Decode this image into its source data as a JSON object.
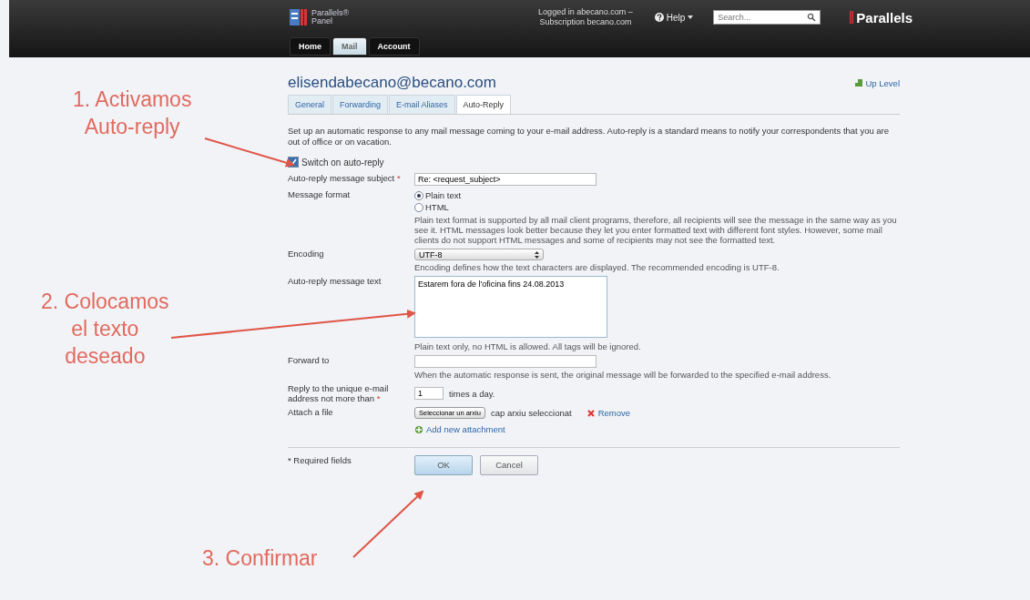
{
  "header": {
    "logo_text": "Parallels®\nPanel",
    "login_info": "Logged in abecano.com –\nSubscription becano.com",
    "help": "Help",
    "search": {
      "placeholder": "Search..."
    },
    "brand": "Parallels"
  },
  "nav_tabs": [
    {
      "label": "Home",
      "selected": false
    },
    {
      "label": "Mail",
      "selected": true
    },
    {
      "label": "Account",
      "selected": false
    }
  ],
  "title": "elisendabecano@becano.com",
  "up_level": "Up Level",
  "sub_tabs": [
    {
      "label": "General",
      "selected": false
    },
    {
      "label": "Forwarding",
      "selected": false
    },
    {
      "label": "E-mail Aliases",
      "selected": false
    },
    {
      "label": "Auto-Reply",
      "selected": true
    }
  ],
  "intro": "Set up an automatic response to any mail message coming to your e-mail address. Auto-reply is a standard means to notify your correspondents that you are out of office or on vacation.",
  "switch": {
    "label": "Switch on auto-reply",
    "checked": true
  },
  "subject": {
    "label": "Auto-reply message subject",
    "required": true,
    "value": "Re: <request_subject>"
  },
  "format": {
    "label": "Message format",
    "options": [
      {
        "label": "Plain text",
        "selected": true
      },
      {
        "label": "HTML",
        "selected": false
      }
    ],
    "hint": "Plain text format is supported by all mail client programs, therefore, all recipients will see the message in the same way as you see it. HTML messages look better because they let you enter formatted text with different font styles. However, some mail clients do not support HTML messages and some of recipients may not see the formatted text."
  },
  "encoding": {
    "label": "Encoding",
    "value": "UTF-8",
    "hint": "Encoding defines how the text characters are displayed. The recommended encoding is UTF-8."
  },
  "message": {
    "label": "Auto-reply message text",
    "value": "Estarem fora de l'oficina fins 24.08.2013",
    "hint": "Plain text only, no HTML is allowed. All tags will be ignored."
  },
  "forward": {
    "label": "Forward to",
    "hint": "When the automatic response is sent, the original message will be forwarded to the specified e-mail address."
  },
  "frequency": {
    "label": "Reply to the unique e-mail address not more than",
    "required": true,
    "value": "1",
    "unit": "times a day."
  },
  "attach": {
    "label": "Attach a file",
    "button": "Seleccionar un arxiu",
    "status": "cap arxiu seleccionat",
    "remove": "Remove",
    "add": "Add new attachment"
  },
  "required_mark": "*",
  "required_note": "* Required fields",
  "buttons": [
    {
      "label": "OK",
      "kind": "primary"
    },
    {
      "label": "Cancel",
      "kind": "secondary"
    }
  ],
  "annotations": [
    "1. Activamos\nAuto-reply",
    "2. Colocamos\nel texto\ndeseado",
    "3. Confirmar"
  ]
}
